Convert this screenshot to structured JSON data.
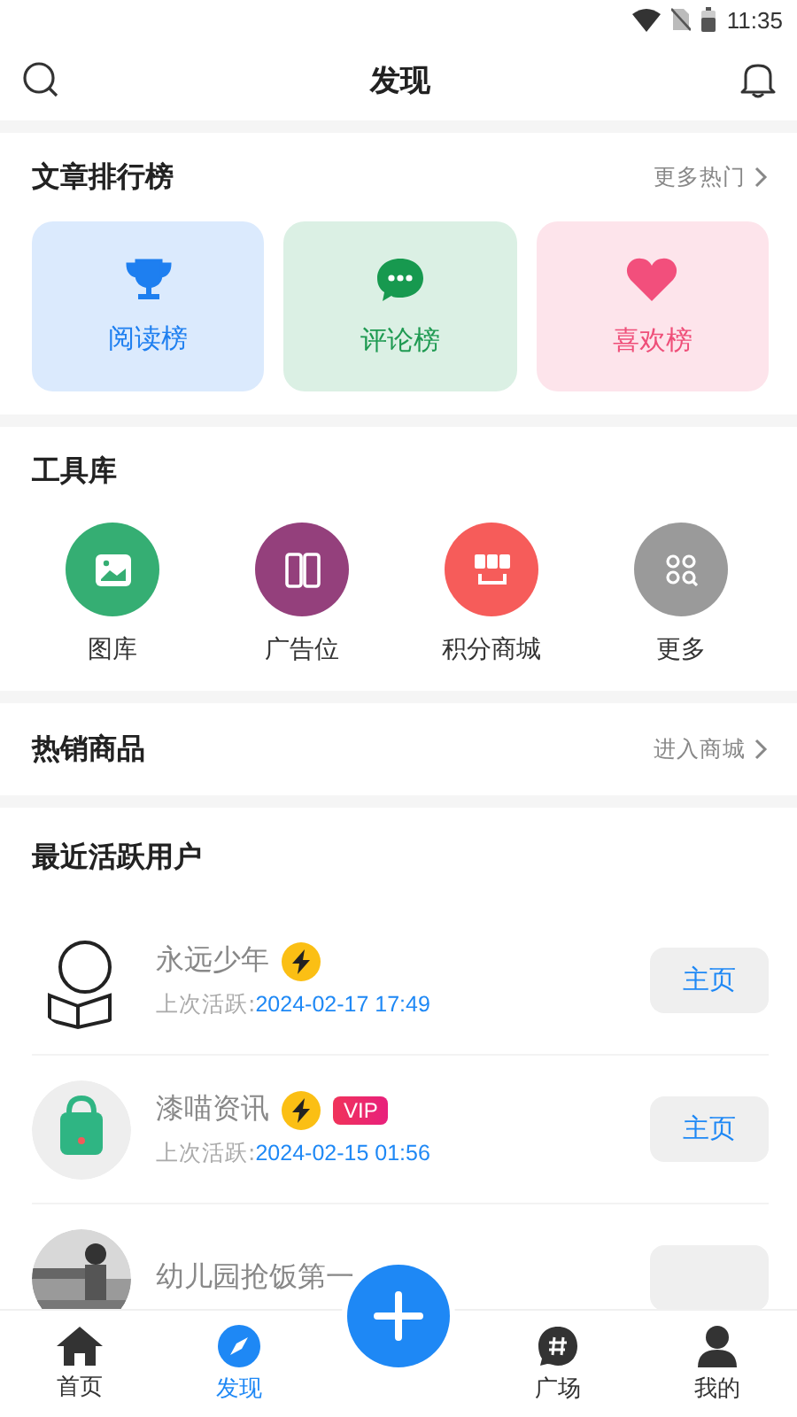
{
  "status_bar": {
    "time": "11:35"
  },
  "header": {
    "title": "发现"
  },
  "rankings": {
    "title": "文章排行榜",
    "more": "更多热门",
    "cards": [
      {
        "kind": "trophy",
        "label": "阅读榜"
      },
      {
        "kind": "chat",
        "label": "评论榜"
      },
      {
        "kind": "heart",
        "label": "喜欢榜"
      }
    ]
  },
  "tools": {
    "title": "工具库",
    "items": [
      {
        "kind": "gallery",
        "label": "图库"
      },
      {
        "kind": "ad",
        "label": "广告位"
      },
      {
        "kind": "shop",
        "label": "积分商城"
      },
      {
        "kind": "more",
        "label": "更多"
      }
    ]
  },
  "hot_goods": {
    "title": "热销商品",
    "more": "进入商城"
  },
  "active_users": {
    "title": "最近活跃用户",
    "users": [
      {
        "name": "永远少年",
        "flash": true,
        "active_label": "上次活跃:",
        "active_time": "2024-02-17 17:49",
        "button": "主页"
      },
      {
        "name": "漆喵资讯",
        "flash": true,
        "vip": "VIP",
        "active_label": "上次活跃:",
        "active_time": "2024-02-15 01:56",
        "button": "主页"
      },
      {
        "name": "幼儿园抢饭第一"
      }
    ]
  },
  "nav": [
    {
      "kind": "home",
      "label": "首页",
      "selected": false
    },
    {
      "kind": "discover",
      "label": "发现",
      "selected": true
    },
    {
      "kind": "add"
    },
    {
      "kind": "square",
      "label": "广场",
      "selected": false
    },
    {
      "kind": "mine",
      "label": "我的",
      "selected": false
    }
  ]
}
